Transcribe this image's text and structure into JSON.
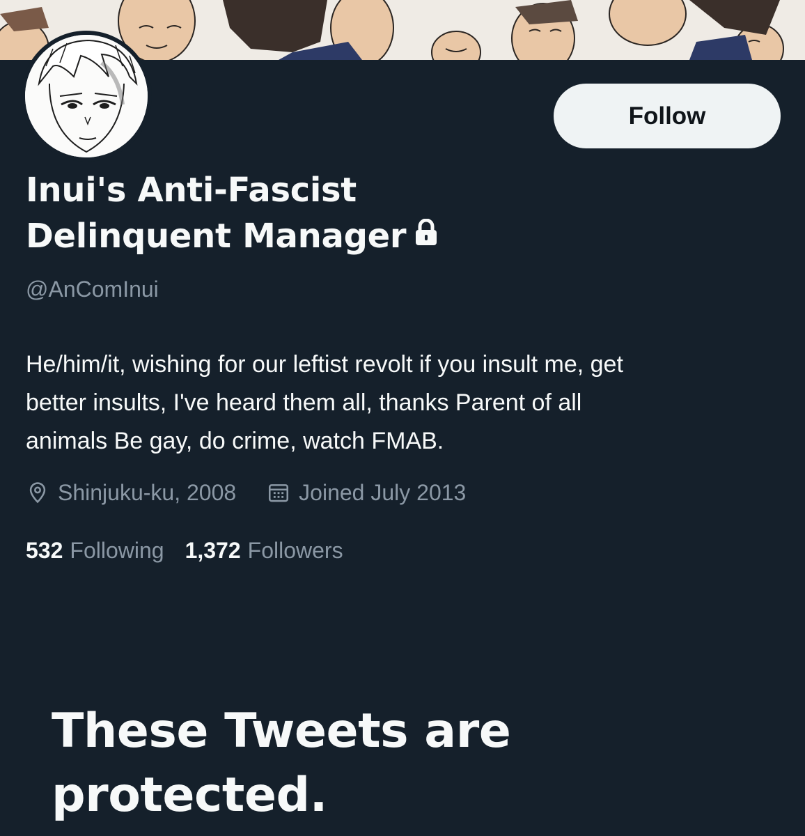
{
  "banner": {
    "description_icon": "manga-crowd-banner"
  },
  "profile": {
    "avatar_icon": "manga-character-avatar",
    "follow_label": "Follow",
    "display_name_line1": "Inui's Anti-Fascist",
    "display_name_line2": "Delinquent Manager",
    "protected_icon": "lock-icon",
    "handle": "@AnComInui",
    "bio_line1": "He/him/it, wishing for our leftist revolt if you insult me, get",
    "bio_line2": "better insults, I've heard them all, thanks Parent of all",
    "bio_line3": "animals Be gay, do crime, watch FMAB.",
    "location": "Shinjuku-ku, 2008",
    "joined": "Joined July 2013",
    "following_count": "532",
    "following_label": "Following",
    "followers_count": "1,372",
    "followers_label": "Followers"
  },
  "protected_notice": {
    "line1": "These Tweets are",
    "line2": "protected."
  },
  "colors": {
    "background": "#15202b",
    "text_primary": "#f7f9f9",
    "text_secondary": "#8b98a5",
    "button_bg": "#eff3f4",
    "button_text": "#0f1419"
  }
}
